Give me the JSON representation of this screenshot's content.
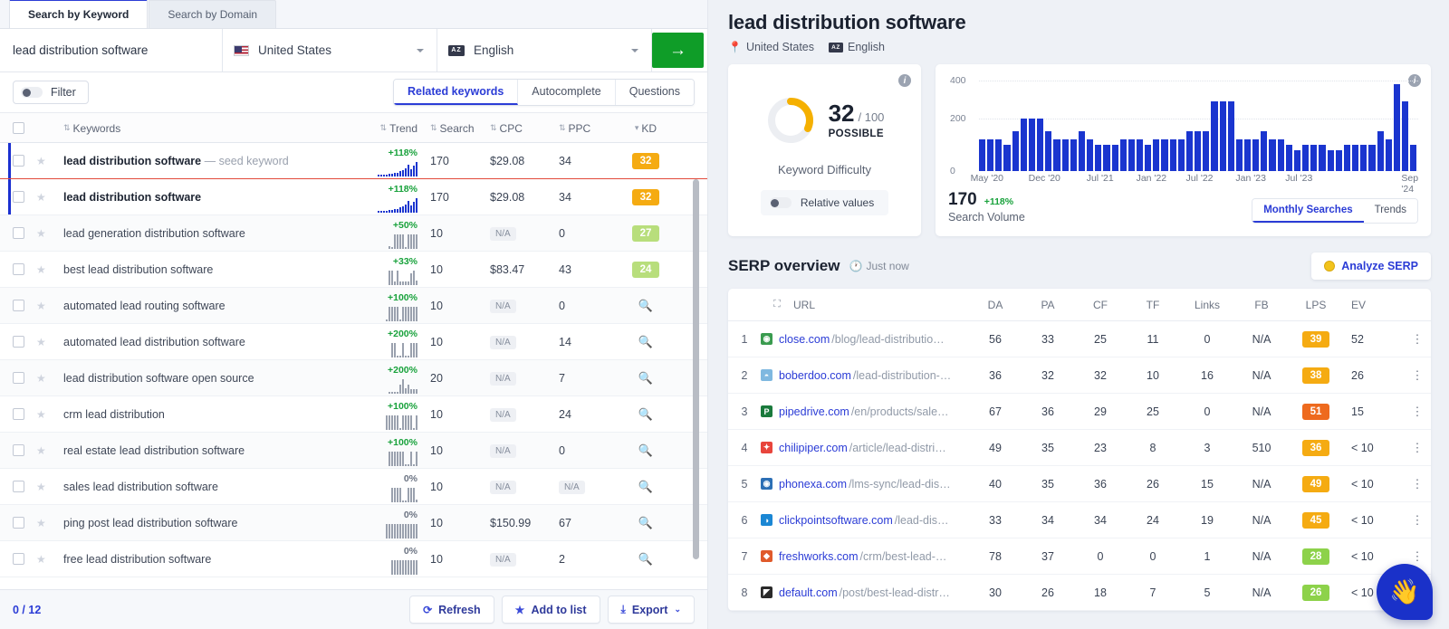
{
  "left": {
    "tabs": [
      {
        "label": "Search by Keyword",
        "active": true
      },
      {
        "label": "Search by Domain",
        "active": false
      }
    ],
    "search": {
      "keyword_value": "lead distribution software",
      "country": "United States",
      "language": "English",
      "lang_icon_text": "AZ",
      "go_icon": "arrow-right-icon"
    },
    "filter_label": "Filter",
    "view_tabs": [
      {
        "label": "Related keywords",
        "active": true
      },
      {
        "label": "Autocomplete",
        "active": false
      },
      {
        "label": "Questions",
        "active": false
      }
    ],
    "columns": {
      "keywords": "Keywords",
      "trend": "Trend",
      "search": "Search",
      "cpc": "CPC",
      "ppc": "PPC",
      "kd": "KD"
    },
    "rows": [
      {
        "keyword": "lead distribution software",
        "seed": "— seed keyword",
        "bold": true,
        "selected": true,
        "trend": "+118%",
        "search": "170",
        "cpc": "$29.08",
        "ppc": "34",
        "kd": "32",
        "kd_color": "#f5ab12",
        "spark_blue": true,
        "spark": [
          2,
          2,
          2,
          2,
          3,
          3,
          4,
          4,
          6,
          7,
          9,
          13,
          8,
          12,
          16
        ]
      },
      {
        "keyword": "lead distribution software",
        "seed": "",
        "bold": true,
        "selected": true,
        "trend": "+118%",
        "search": "170",
        "cpc": "$29.08",
        "ppc": "34",
        "kd": "32",
        "kd_color": "#f5ab12",
        "spark_blue": true,
        "spark": [
          2,
          2,
          2,
          2,
          3,
          3,
          4,
          4,
          6,
          7,
          9,
          13,
          8,
          12,
          16
        ]
      },
      {
        "keyword": "lead generation distribution software",
        "seed": "",
        "bold": false,
        "selected": false,
        "trend": "+50%",
        "search": "10",
        "cpc": "N/A",
        "ppc": "0",
        "kd": "27",
        "kd_color": "#b8de7c",
        "spark_blue": false,
        "spark": [
          3,
          1,
          14,
          14,
          14,
          14,
          1,
          14,
          14,
          14,
          14
        ]
      },
      {
        "keyword": "best lead distribution software",
        "seed": "",
        "bold": false,
        "selected": false,
        "trend": "+33%",
        "search": "10",
        "cpc": "$83.47",
        "ppc": "43",
        "kd": "24",
        "kd_color": "#b8de7c",
        "spark_blue": false,
        "spark": [
          15,
          15,
          4,
          15,
          4,
          4,
          4,
          4,
          12,
          15,
          5
        ]
      },
      {
        "keyword": "automated lead routing software",
        "seed": "",
        "bold": false,
        "selected": false,
        "trend": "+100%",
        "search": "10",
        "cpc": "N/A",
        "ppc": "0",
        "kd": "search-icon",
        "kd_color": "",
        "spark_blue": false,
        "spark": [
          1,
          12,
          12,
          12,
          12,
          1,
          12,
          12,
          12,
          12,
          12,
          12
        ]
      },
      {
        "keyword": "automated lead distribution software",
        "seed": "",
        "bold": false,
        "selected": false,
        "trend": "+200%",
        "search": "10",
        "cpc": "N/A",
        "ppc": "14",
        "kd": "search-icon",
        "kd_color": "",
        "spark_blue": false,
        "spark": [
          12,
          12,
          1,
          1,
          12,
          1,
          1,
          12,
          12,
          12
        ]
      },
      {
        "keyword": "lead distribution software open source",
        "seed": "",
        "bold": false,
        "selected": false,
        "trend": "+200%",
        "search": "20",
        "cpc": "N/A",
        "ppc": "7",
        "kd": "search-icon",
        "kd_color": "",
        "spark_blue": false,
        "spark": [
          1,
          1,
          1,
          1,
          9,
          14,
          5,
          9,
          4,
          4,
          4
        ]
      },
      {
        "keyword": "crm lead distribution",
        "seed": "",
        "bold": false,
        "selected": false,
        "trend": "+100%",
        "search": "10",
        "cpc": "N/A",
        "ppc": "24",
        "kd": "search-icon",
        "kd_color": "",
        "spark_blue": false,
        "spark": [
          13,
          13,
          13,
          13,
          13,
          1,
          13,
          13,
          13,
          13,
          1,
          13
        ]
      },
      {
        "keyword": "real estate lead distribution software",
        "seed": "",
        "bold": false,
        "selected": false,
        "trend": "+100%",
        "search": "10",
        "cpc": "N/A",
        "ppc": "0",
        "kd": "search-icon",
        "kd_color": "",
        "spark_blue": false,
        "spark": [
          14,
          14,
          14,
          14,
          14,
          14,
          1,
          1,
          14,
          1,
          14
        ]
      },
      {
        "keyword": "sales lead distribution software",
        "seed": "",
        "bold": false,
        "selected": false,
        "trend": "0%",
        "search": "10",
        "cpc": "N/A",
        "ppc": "N/A",
        "kd": "search-icon",
        "kd_color": "",
        "spark_blue": false,
        "spark": [
          10,
          10,
          10,
          10,
          1,
          1,
          10,
          10,
          10,
          2
        ]
      },
      {
        "keyword": "ping post lead distribution software",
        "seed": "",
        "bold": false,
        "selected": false,
        "trend": "0%",
        "search": "10",
        "cpc": "$150.99",
        "ppc": "67",
        "kd": "search-icon",
        "kd_color": "",
        "spark_blue": false,
        "spark": [
          15,
          15,
          15,
          15,
          15,
          15,
          15,
          15,
          15,
          15,
          15,
          15
        ]
      },
      {
        "keyword": "free lead distribution software",
        "seed": "",
        "bold": false,
        "selected": false,
        "trend": "0%",
        "search": "10",
        "cpc": "N/A",
        "ppc": "2",
        "kd": "search-icon",
        "kd_color": "",
        "spark_blue": false,
        "spark": [
          12,
          12,
          12,
          12,
          12,
          12,
          12,
          12,
          12,
          12
        ]
      }
    ],
    "footer": {
      "count": "0 / 12",
      "refresh": "Refresh",
      "add_to_list": "Add to list",
      "export": "Export"
    }
  },
  "right": {
    "title": "lead distribution software",
    "country": "United States",
    "language": "English",
    "lang_icon_text": "AZ",
    "kd_card": {
      "value": "32",
      "out_of": "/ 100",
      "level": "POSSIBLE",
      "caption": "Keyword Difficulty",
      "toggle_label": "Relative values",
      "gauge_color": "#f5b000",
      "gauge_percent": 32
    },
    "volume_card": {
      "value": "170",
      "change": "+118%",
      "caption": "Search Volume",
      "segs": [
        {
          "label": "Monthly Searches",
          "active": true
        },
        {
          "label": "Trends",
          "active": false
        }
      ]
    },
    "serp": {
      "title": "SERP overview",
      "when": "Just now",
      "analyze_label": "Analyze SERP",
      "columns": [
        "URL",
        "DA",
        "PA",
        "CF",
        "TF",
        "Links",
        "FB",
        "LPS",
        "EV"
      ],
      "rows": [
        {
          "rank": "1",
          "domain": "close.com",
          "path": "/blog/lead-distributio…",
          "da": "56",
          "pa": "33",
          "cf": "25",
          "tf": "11",
          "links": "0",
          "fb": "N/A",
          "lps": "39",
          "lps_color": "#f5ab12",
          "ev": "52",
          "fav": "◉",
          "fav_bg": "#3a9b4f"
        },
        {
          "rank": "2",
          "domain": "boberdoo.com",
          "path": "/lead-distribution-…",
          "da": "36",
          "pa": "32",
          "cf": "32",
          "tf": "10",
          "links": "16",
          "fb": "N/A",
          "lps": "38",
          "lps_color": "#f5ab12",
          "ev": "26",
          "fav": "◓",
          "fav_bg": "#7fb8e0"
        },
        {
          "rank": "3",
          "domain": "pipedrive.com",
          "path": "/en/products/sale…",
          "da": "67",
          "pa": "36",
          "cf": "29",
          "tf": "25",
          "links": "0",
          "fb": "N/A",
          "lps": "51",
          "lps_color": "#ee6a1e",
          "ev": "15",
          "fav": "P",
          "fav_bg": "#1a7a3c"
        },
        {
          "rank": "4",
          "domain": "chilipiper.com",
          "path": "/article/lead-distri…",
          "da": "49",
          "pa": "35",
          "cf": "23",
          "tf": "8",
          "links": "3",
          "fb": "510",
          "lps": "36",
          "lps_color": "#f5ab12",
          "ev": "< 10",
          "fav": "✦",
          "fav_bg": "#e8453c"
        },
        {
          "rank": "5",
          "domain": "phonexa.com",
          "path": "/lms-sync/lead-dis…",
          "da": "40",
          "pa": "35",
          "cf": "36",
          "tf": "26",
          "links": "15",
          "fb": "N/A",
          "lps": "49",
          "lps_color": "#f5ab12",
          "ev": "< 10",
          "fav": "◉",
          "fav_bg": "#2c6fb5"
        },
        {
          "rank": "6",
          "domain": "clickpointsoftware.com",
          "path": "/lead-dis…",
          "da": "33",
          "pa": "34",
          "cf": "34",
          "tf": "24",
          "links": "19",
          "fb": "N/A",
          "lps": "45",
          "lps_color": "#f5ab12",
          "ev": "< 10",
          "fav": "◑",
          "fav_bg": "#1b87d4"
        },
        {
          "rank": "7",
          "domain": "freshworks.com",
          "path": "/crm/best-lead-…",
          "da": "78",
          "pa": "37",
          "cf": "0",
          "tf": "0",
          "links": "1",
          "fb": "N/A",
          "lps": "28",
          "lps_color": "#8dd24a",
          "ev": "< 10",
          "fav": "◆",
          "fav_bg": "#e05a2b"
        },
        {
          "rank": "8",
          "domain": "default.com",
          "path": "/post/best-lead-distr…",
          "da": "30",
          "pa": "26",
          "cf": "18",
          "tf": "7",
          "links": "5",
          "fb": "N/A",
          "lps": "26",
          "lps_color": "#8dd24a",
          "ev": "< 10",
          "fav": "◤",
          "fav_bg": "#2a2a2a"
        }
      ]
    },
    "chat_icon": "👋"
  },
  "chart_data": {
    "type": "bar",
    "title": "Search Volume",
    "xlabel": "",
    "ylabel": "",
    "ylim": [
      0,
      480
    ],
    "yticks": [
      0,
      200,
      400
    ],
    "grid": true,
    "series_color": "#1a35cf",
    "tick_labels": [
      {
        "label": "May '20",
        "index": 0
      },
      {
        "label": "Dec '20",
        "index": 7
      },
      {
        "label": "Jul '21",
        "index": 14
      },
      {
        "label": "Jan '22",
        "index": 20
      },
      {
        "label": "Jul '22",
        "index": 26
      },
      {
        "label": "Jan '23",
        "index": 32
      },
      {
        "label": "Jul '23",
        "index": 38
      },
      {
        "label": "Sep '24",
        "index": 52
      }
    ],
    "values": [
      170,
      170,
      170,
      140,
      210,
      280,
      280,
      280,
      210,
      170,
      170,
      170,
      210,
      170,
      140,
      140,
      140,
      170,
      170,
      170,
      140,
      170,
      170,
      170,
      170,
      210,
      210,
      210,
      370,
      370,
      370,
      170,
      170,
      170,
      210,
      170,
      170,
      140,
      110,
      140,
      140,
      140,
      110,
      110,
      140,
      140,
      140,
      140,
      210,
      170,
      460,
      370,
      140
    ]
  }
}
